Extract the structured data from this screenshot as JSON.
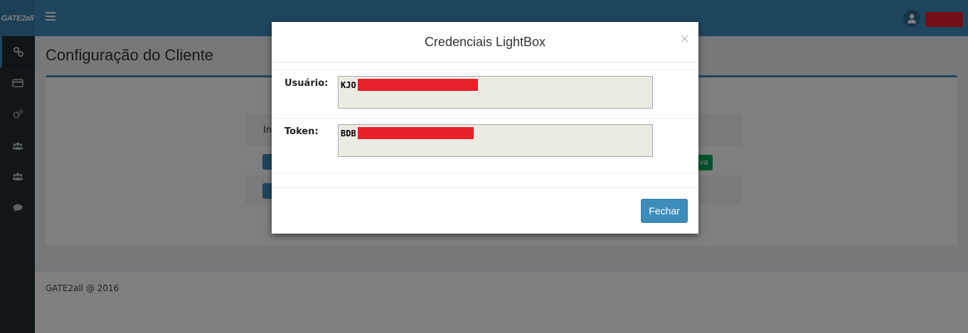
{
  "header": {
    "logo_text": "GATE2all",
    "menu_icon": "hamburger-icon",
    "user_icon": "user-icon"
  },
  "sidebar": {
    "items": [
      {
        "icon": "link-icon",
        "active": true
      },
      {
        "icon": "credit-card-icon",
        "active": false
      },
      {
        "icon": "gears-icon",
        "active": false
      },
      {
        "icon": "users-icon",
        "active": false
      },
      {
        "icon": "group-icon",
        "active": false
      },
      {
        "icon": "comment-icon",
        "active": false
      }
    ]
  },
  "main": {
    "page_title": "Configuração do Cliente",
    "row_text_fragment": "Int",
    "green_button_fragment": "ova"
  },
  "footer": {
    "text": "GATE2all @ 2016"
  },
  "modal": {
    "title": "Credenciais LightBox",
    "close_glyph": "×",
    "fields": [
      {
        "label": "Usuário:",
        "value": "KJO"
      },
      {
        "label": "Token:",
        "value": "BDB"
      }
    ],
    "close_button_label": "Fechar"
  },
  "colors": {
    "accent": "#3c8dbc",
    "sidebar": "#222d32",
    "redaction": "#e8202a",
    "success": "#00a65a"
  }
}
